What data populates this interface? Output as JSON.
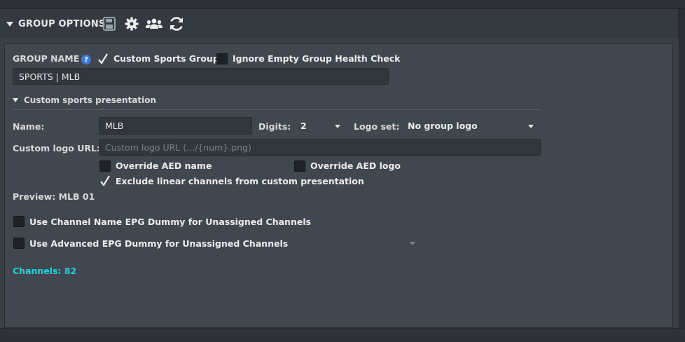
{
  "header": {
    "title": "GROUP OPTIONS",
    "icons": [
      "save-icon",
      "gear-icon",
      "users-icon",
      "refresh-icon"
    ]
  },
  "group": {
    "name_label": "GROUP NAME",
    "custom_sports_label": "Custom Sports Group",
    "custom_sports_checked": true,
    "ignore_health_label": "Ignore Empty Group Health Check",
    "ignore_health_checked": false,
    "name_value": "SPORTS | MLB"
  },
  "presentation": {
    "section_label": "Custom sports presentation",
    "name_label": "Name:",
    "name_value": "MLB",
    "digits_label": "Digits:",
    "digits_value": "2",
    "logo_set_label": "Logo set:",
    "logo_set_value": "No group logo",
    "custom_logo_label": "Custom logo URL:",
    "custom_logo_placeholder": "Custom logo URL (.../{num}.png)",
    "override_name_label": "Override AED name",
    "override_name_checked": false,
    "override_logo_label": "Override AED logo",
    "override_logo_checked": false,
    "exclude_linear_label": "Exclude linear channels from custom presentation",
    "exclude_linear_checked": true,
    "preview": "Preview: MLB 01"
  },
  "epg": {
    "channel_name_dummy_label": "Use Channel Name EPG Dummy for Unassigned Channels",
    "channel_name_dummy_checked": false,
    "advanced_dummy_label": "Use Advanced EPG Dummy for Unassigned Channels",
    "advanced_dummy_checked": false
  },
  "channels": "Channels: 82",
  "colors": {
    "accent_cyan": "#1fd6e0",
    "help_blue": "#3b7ad9"
  }
}
